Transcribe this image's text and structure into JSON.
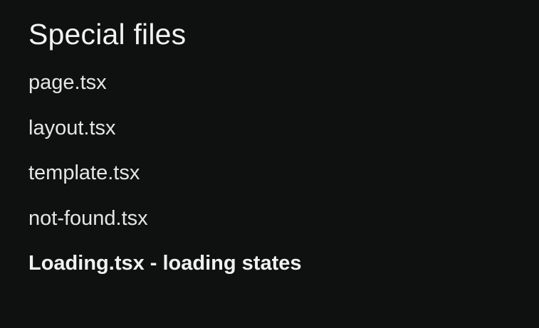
{
  "page": {
    "title": "Special files"
  },
  "files": {
    "items": [
      {
        "label": "page.tsx",
        "active": false
      },
      {
        "label": "layout.tsx",
        "active": false
      },
      {
        "label": "template.tsx",
        "active": false
      },
      {
        "label": "not-found.tsx",
        "active": false
      },
      {
        "label": "Loading.tsx - loading states",
        "active": true
      }
    ]
  },
  "colors": {
    "background": "#0f1111",
    "text": "#e7e9e8"
  }
}
